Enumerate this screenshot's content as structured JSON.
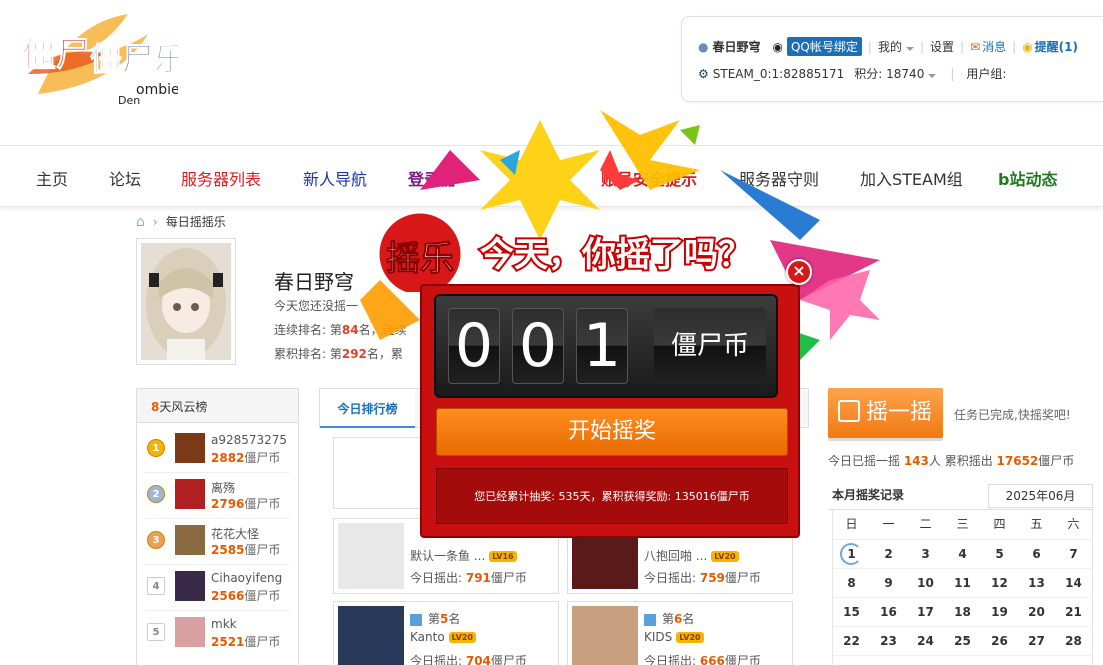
{
  "logo": {
    "main": "僵尸乐园",
    "sub1": "ombie",
    "sub2": "Den"
  },
  "userbox": {
    "username": "春日野穹",
    "qq_bind": "QQ帐号绑定",
    "mine": "我的",
    "settings": "设置",
    "messages": "消息",
    "reminders": "提醒(1)",
    "steam": "STEAM_0:1:82885171",
    "points": "积分: 18740",
    "usergroup": "用户组:"
  },
  "nav": [
    {
      "label": "主页",
      "color": "#333333"
    },
    {
      "label": "论坛",
      "color": "#333333"
    },
    {
      "label": "服务器列表",
      "color": "#d81e1e"
    },
    {
      "label": "新人导航",
      "color": "#1a35a8"
    },
    {
      "label": "登录器",
      "color": "#7a1a8a"
    },
    {
      "label": "账号安全提示",
      "color": "#d81e1e"
    },
    {
      "label": "服务器守则",
      "color": "#333333"
    },
    {
      "label": "加入STEAM组",
      "color": "#333333"
    },
    {
      "label": "b站动态",
      "color": "#1f7a1f"
    }
  ],
  "breadcrumb": {
    "current": "每日摇摇乐"
  },
  "profile": {
    "name": "春日野穹",
    "line1": "今天您还没摇一",
    "line2_prefix": "连续排名: 第",
    "line2_rank": "84",
    "line2_suffix": "名，连续",
    "line3_prefix": "累积排名: 第",
    "line3_rank": "292",
    "line3_suffix": "名，累"
  },
  "board": {
    "title_num": "8",
    "title_text": "天风云榜",
    "unit": "僵尸币",
    "rows": [
      {
        "rank": "1",
        "name": "a928573275",
        "score": "2882"
      },
      {
        "rank": "2",
        "name": "离殇",
        "score": "2796"
      },
      {
        "rank": "3",
        "name": "花花大怪",
        "score": "2585"
      },
      {
        "rank": "4",
        "name": "Cihaoyifeng",
        "score": "2566"
      },
      {
        "rank": "5",
        "name": "mkk",
        "score": "2521"
      }
    ]
  },
  "tabs": {
    "today": "今日排行榜"
  },
  "cards": {
    "rank_prefix": "第",
    "rank_suffix": "名",
    "today_label": "今日摇出: ",
    "unit": "僵尸币",
    "items": [
      {
        "name": "默认一条鱼 ...",
        "level": "LV16",
        "amount": "791"
      },
      {
        "name": "八抱回啪 ...",
        "level": "LV20",
        "amount": "759"
      },
      {
        "rank": "5",
        "name": "Kanto",
        "level": "LV20",
        "amount": "704"
      },
      {
        "rank": "6",
        "name": "KIDS",
        "level": "LV20",
        "amount": "666"
      }
    ]
  },
  "shake": {
    "button": "摇一摇",
    "task": "任务已完成,快摇奖吧!",
    "today_prefix": "今日已摇一摇 ",
    "today_count": "143",
    "today_mid": "人 累积摇出 ",
    "today_total": "17652",
    "today_unit": "僵尸币"
  },
  "calendar": {
    "title": "本月摇奖记录",
    "month": "2025年06月",
    "weekdays": [
      "日",
      "一",
      "二",
      "三",
      "四",
      "五",
      "六"
    ],
    "weeks": [
      [
        "1",
        "2",
        "3",
        "4",
        "5",
        "6",
        "7"
      ],
      [
        "8",
        "9",
        "10",
        "11",
        "12",
        "13",
        "14"
      ],
      [
        "15",
        "16",
        "17",
        "18",
        "19",
        "20",
        "21"
      ],
      [
        "22",
        "23",
        "24",
        "25",
        "26",
        "27",
        "28"
      ],
      [
        "29",
        "30",
        "",
        "",
        "",
        "",
        ""
      ]
    ]
  },
  "popup": {
    "badge": "摇乐",
    "banner": "今天，你摇了吗？",
    "digits": [
      "0",
      "0",
      "1"
    ],
    "unit": "僵尸币",
    "start": "开始摇奖",
    "stats": "您已经累计抽奖: 535天，累积获得奖励: 135016僵尸币",
    "close": "×"
  }
}
